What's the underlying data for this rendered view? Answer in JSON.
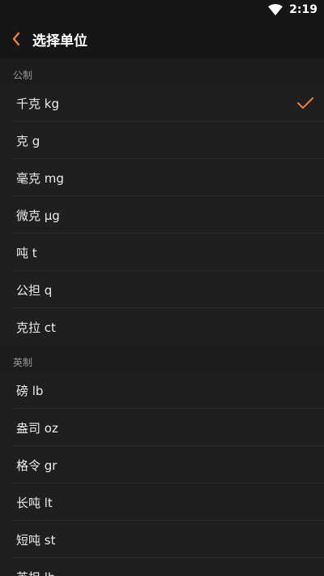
{
  "status_bar": {
    "time": "2:19"
  },
  "app_bar": {
    "title": "选择单位"
  },
  "colors": {
    "accent": "#f0813a"
  },
  "sections": [
    {
      "title": "公制",
      "items": [
        {
          "label": "千克 kg",
          "selected": true
        },
        {
          "label": "克 g",
          "selected": false
        },
        {
          "label": "毫克 mg",
          "selected": false
        },
        {
          "label": "微克 μg",
          "selected": false
        },
        {
          "label": "吨 t",
          "selected": false
        },
        {
          "label": "公担 q",
          "selected": false
        },
        {
          "label": "克拉 ct",
          "selected": false
        }
      ]
    },
    {
      "title": "英制",
      "items": [
        {
          "label": "磅 lb",
          "selected": false
        },
        {
          "label": "盎司 oz",
          "selected": false
        },
        {
          "label": "格令 gr",
          "selected": false
        },
        {
          "label": "长吨 lt",
          "selected": false
        },
        {
          "label": "短吨 st",
          "selected": false
        },
        {
          "label": "英担 lb",
          "selected": false
        }
      ]
    }
  ]
}
